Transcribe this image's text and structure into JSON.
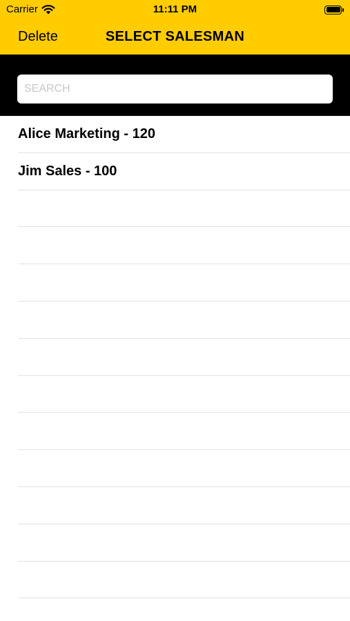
{
  "status_bar": {
    "carrier": "Carrier",
    "time": "11:11 PM",
    "icons": [
      "wifi-icon",
      "battery-icon"
    ]
  },
  "nav": {
    "left_button": "Delete",
    "title": "SELECT SALESMAN"
  },
  "search": {
    "placeholder": "SEARCH",
    "value": ""
  },
  "list": {
    "items": [
      {
        "label": "Alice Marketing - 120"
      },
      {
        "label": "Jim Sales - 100"
      }
    ],
    "empty_rows": 11
  },
  "colors": {
    "header_background": "#FFCC00",
    "search_bar_background": "#000000",
    "separator": "#e2e2e2"
  }
}
